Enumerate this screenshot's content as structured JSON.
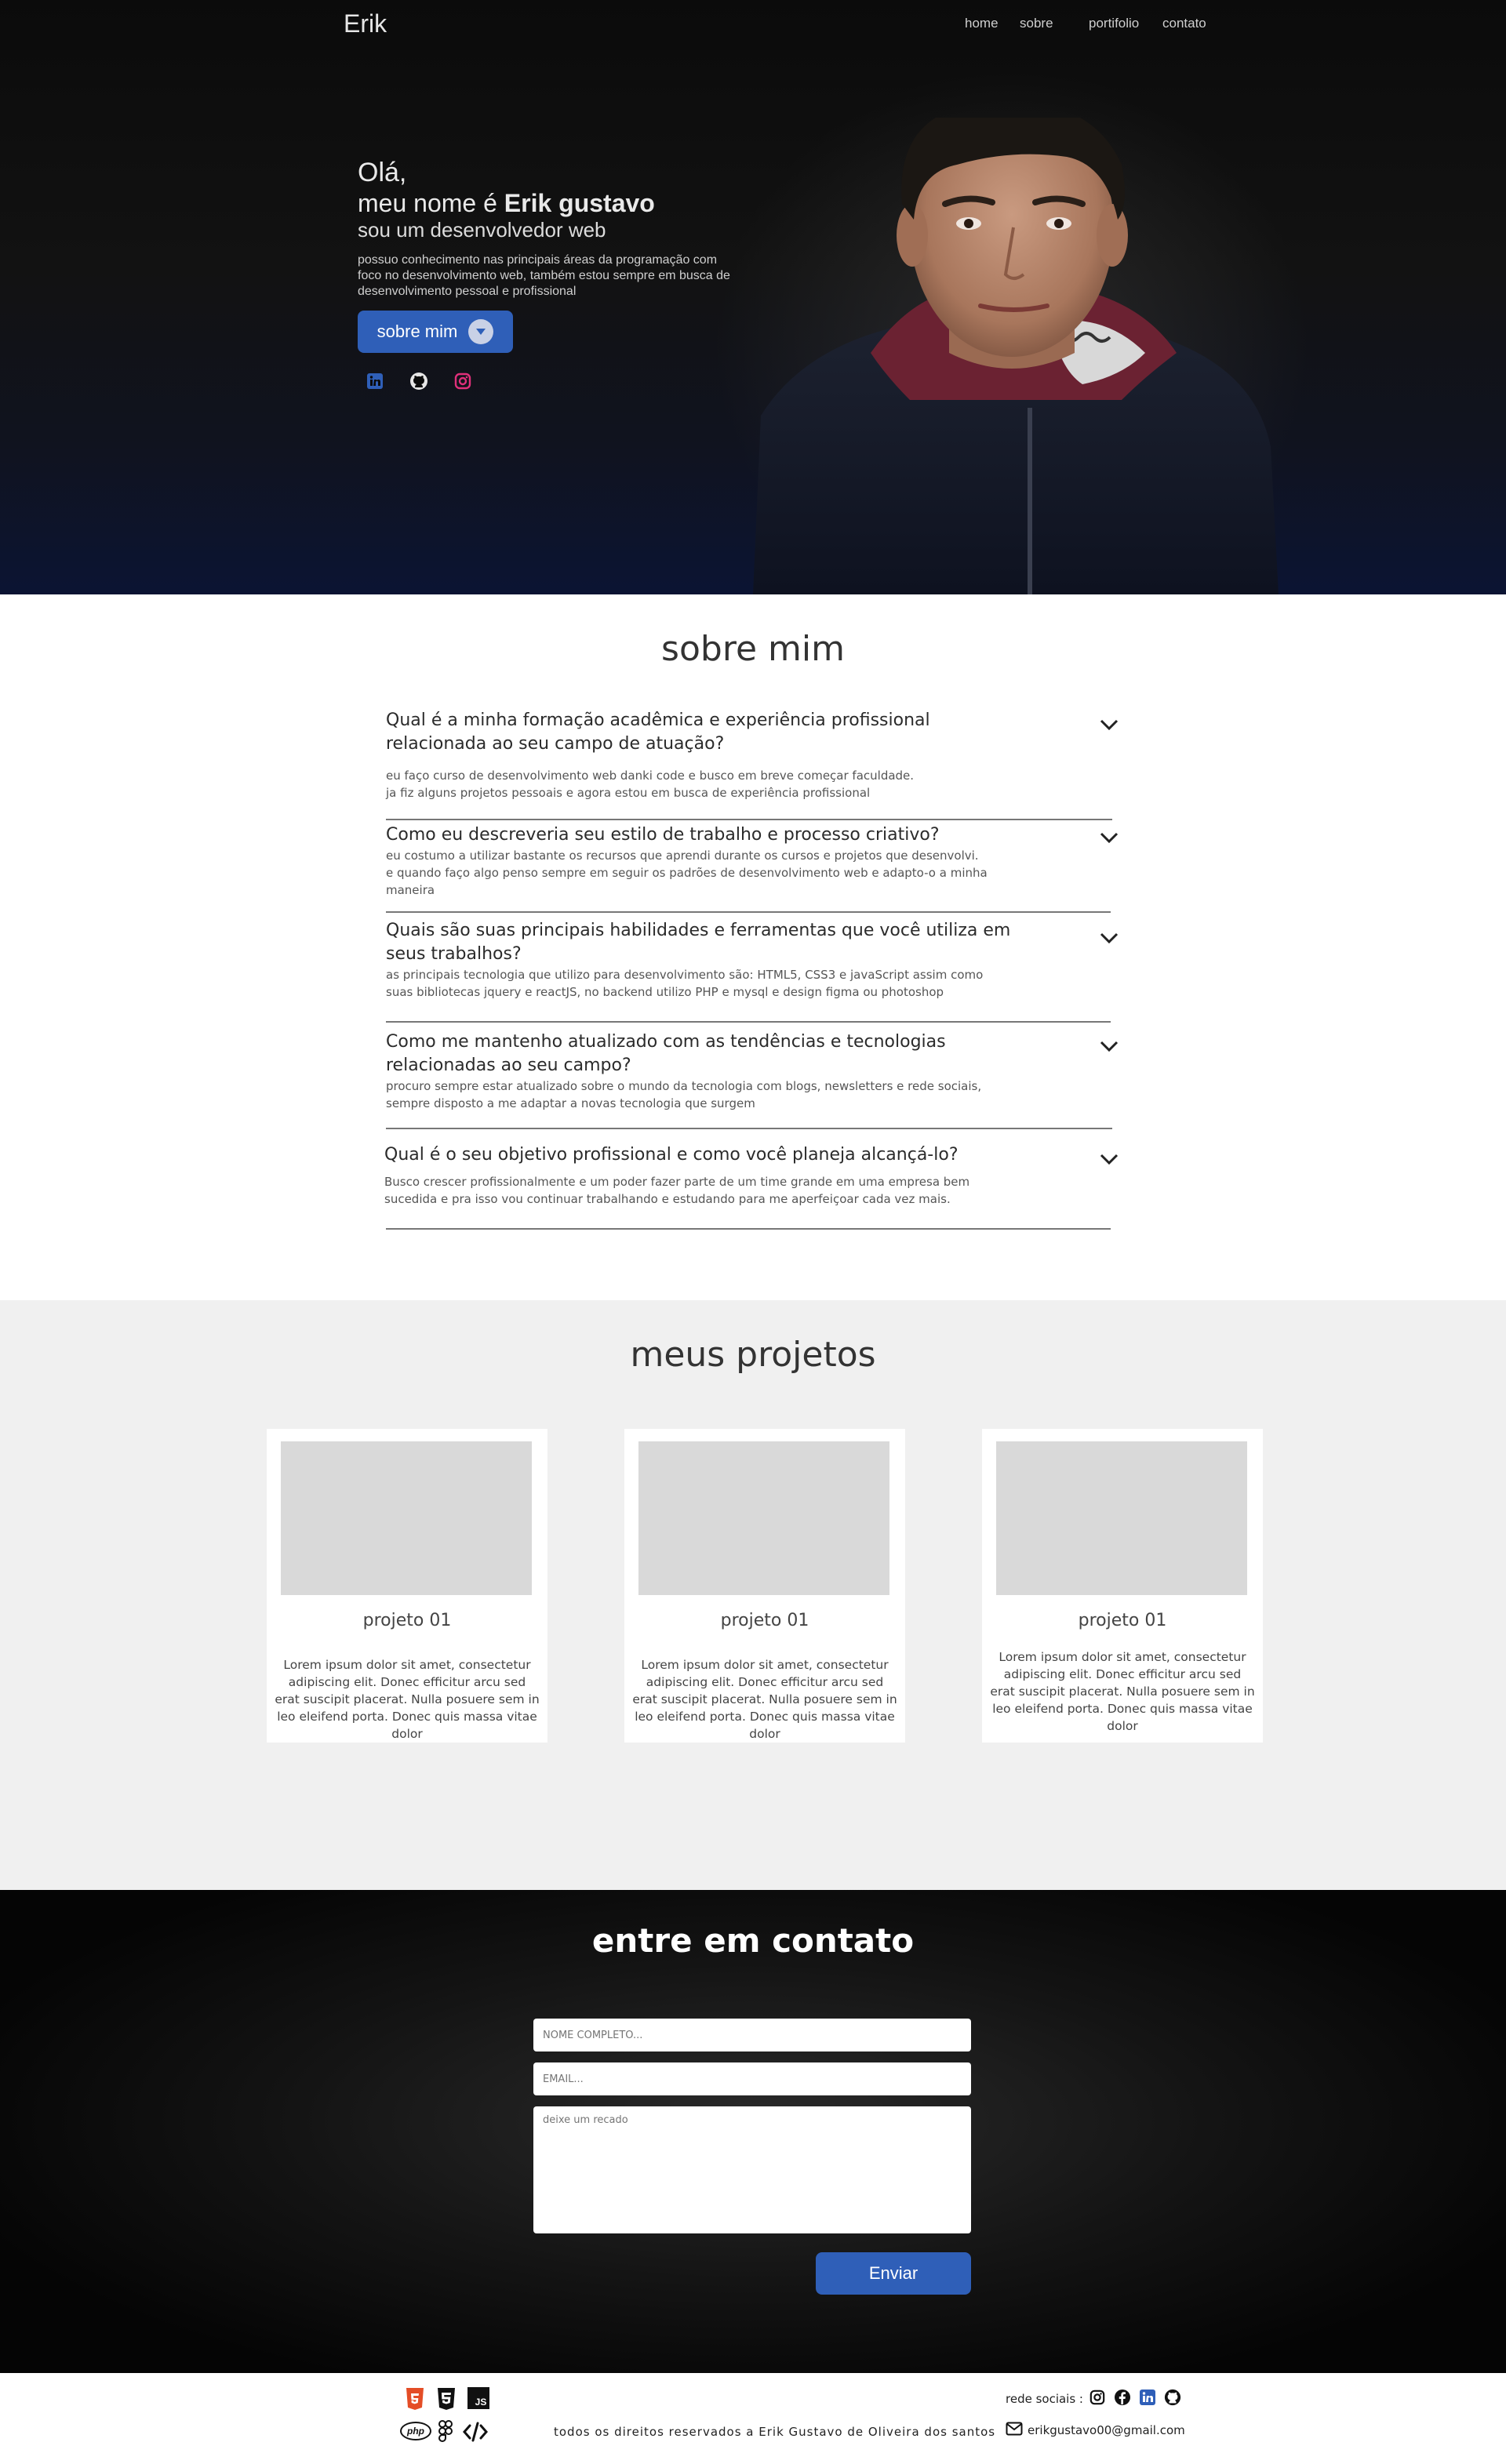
{
  "header": {
    "logo": "Erik",
    "nav": [
      "home",
      "sobre",
      "portifolio",
      "contato"
    ]
  },
  "hero": {
    "hello": "Olá,",
    "name_prefix": "meu nome é",
    "name": "Erik gustavo",
    "role": "sou um desenvolvedor web",
    "description": "possuo conhecimento nas principais áreas da programação com foco no desenvolvimento web, também estou sempre em busca de desenvolvimento pessoal e profissional",
    "button": "sobre mim",
    "socials": [
      "linkedin-icon",
      "github-icon",
      "instagram-icon"
    ]
  },
  "about": {
    "title": "sobre mim",
    "faq": [
      {
        "question": "Qual é a minha formação acadêmica e experiência profissional relacionada ao seu campo de atuação?",
        "answer": "eu faço curso de desenvolvimento web danki code e busco em breve começar faculdade.\nja fiz alguns projetos pessoais e agora estou em busca de experiência profissional"
      },
      {
        "question": "Como eu descreveria seu estilo de trabalho e processo criativo?",
        "answer": "eu costumo a utilizar bastante os recursos que aprendi durante os cursos e projetos que desenvolvi.\ne quando faço algo penso sempre em seguir os padrões de desenvolvimento web e adapto-o a minha maneira"
      },
      {
        "question": "Quais são suas principais habilidades e ferramentas que você utiliza em seus trabalhos?",
        "answer": "as principais tecnologia que utilizo para desenvolvimento são: HTML5, CSS3 e javaScript assim como suas bibliotecas jquery e reactJS, no backend utilizo PHP e mysql e design figma ou photoshop"
      },
      {
        "question": "Como me mantenho atualizado com as tendências e tecnologias relacionadas ao seu campo?",
        "answer": "procuro sempre estar atualizado sobre o mundo da tecnologia com blogs, newsletters e rede sociais, sempre disposto a me adaptar a novas tecnologia que surgem"
      },
      {
        "question": "Qual é o seu objetivo profissional e como você planeja alcançá-lo?",
        "answer": "Busco crescer profissionalmente e um poder fazer parte de um time grande em uma empresa bem sucedida e pra isso vou continuar trabalhando e estudando para me aperfeiçoar cada vez mais."
      }
    ]
  },
  "projects": {
    "title": "meus projetos",
    "items": [
      {
        "title": "projeto 01",
        "description": "Lorem ipsum dolor sit amet, consectetur adipiscing elit. Donec efficitur arcu sed erat suscipit placerat. Nulla posuere sem in leo eleifend porta. Donec quis massa vitae dolor"
      },
      {
        "title": "projeto 01",
        "description": "Lorem ipsum dolor sit amet, consectetur adipiscing elit. Donec efficitur arcu sed erat suscipit placerat. Nulla posuere sem in leo eleifend porta. Donec quis massa vitae dolor"
      },
      {
        "title": "projeto 01",
        "description": "Lorem ipsum dolor sit amet, consectetur adipiscing elit. Donec efficitur arcu sed erat suscipit placerat. Nulla posuere sem in leo eleifend porta. Donec quis massa vitae dolor"
      }
    ]
  },
  "contact": {
    "title": "entre em contato",
    "name_placeholder": "NOME COMPLETO...",
    "email_placeholder": "EMAIL...",
    "message_placeholder": "deixe um recado",
    "send": "Enviar"
  },
  "footer": {
    "tech_icons": [
      "html5-icon",
      "css3-icon",
      "js-icon",
      "php-icon",
      "figma-icon",
      "code-icon"
    ],
    "js_label": "JS",
    "php_label": "php",
    "copyright": "todos os direitos reservados a Erik Gustavo de Oliveira dos santos",
    "social_label": "rede sociais :",
    "social_icons": [
      "instagram-icon",
      "facebook-icon",
      "linkedin-icon",
      "github-icon"
    ],
    "email": "erikgustavo00@gmail.com"
  },
  "colors": {
    "accent": "#2f5fb8",
    "linkedin": "#2f5fb8",
    "instagram": "#e0307a",
    "html5": "#e44d26",
    "hero_bg": "#0b0b0b"
  }
}
